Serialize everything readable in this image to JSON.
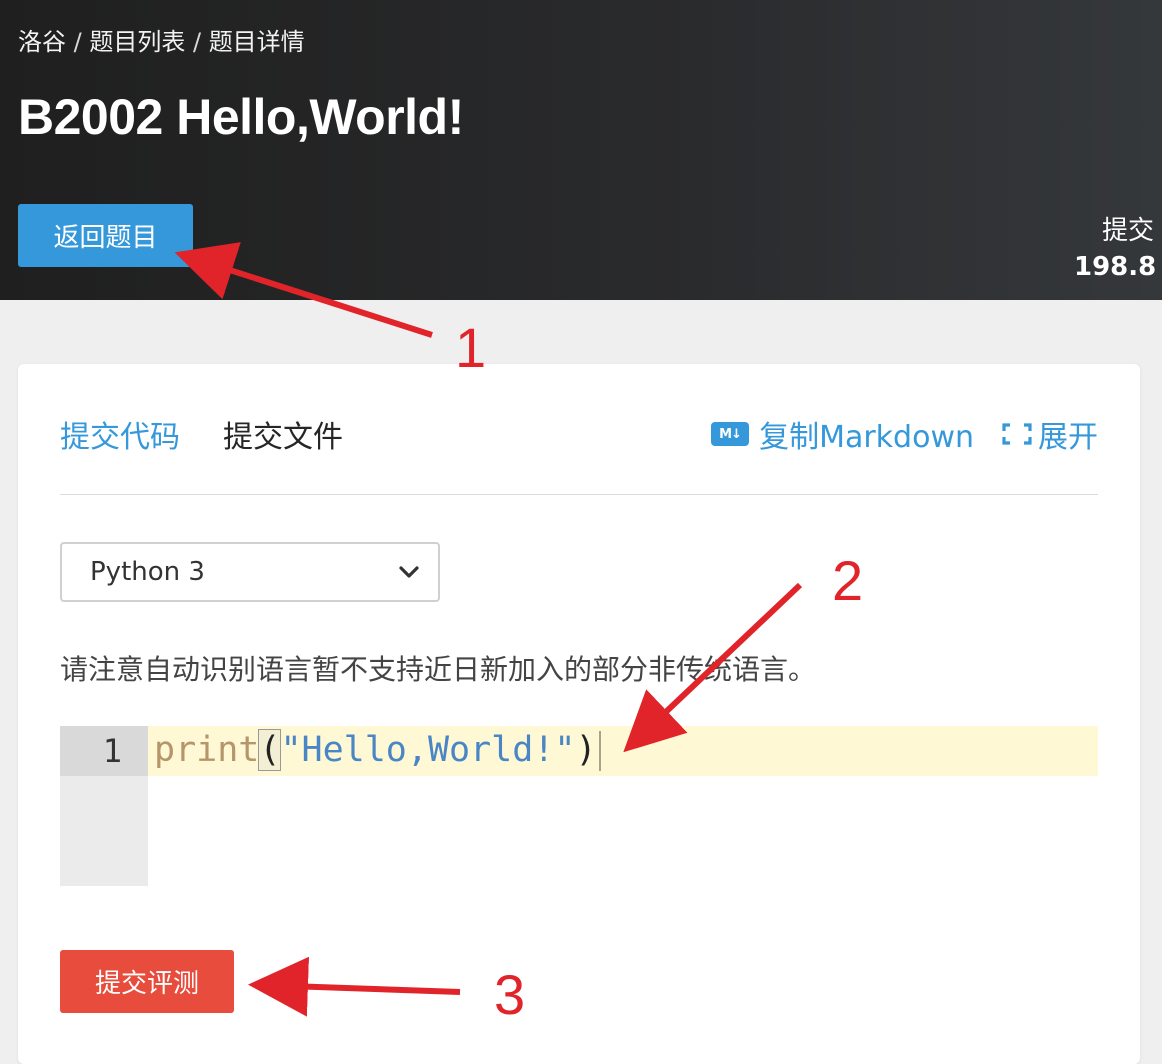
{
  "header": {
    "breadcrumb": [
      "洛谷",
      "题目列表",
      "题目详情"
    ],
    "breadcrumb_sep": " / ",
    "title": "B2002 Hello,World!",
    "back_button": "返回题目",
    "stat_label": "提交",
    "stat_value": "198.8"
  },
  "tabs": [
    {
      "label": "提交代码",
      "active": true
    },
    {
      "label": "提交文件",
      "active": false
    }
  ],
  "actions": {
    "copy_markdown": "复制Markdown",
    "md_icon_text": "M↓",
    "expand": "展开"
  },
  "language_select": {
    "value": "Python 3"
  },
  "notice": "请注意自动识别语言暂不支持近日新加入的部分非传统语言。",
  "editor": {
    "line_number": "1",
    "tokens": {
      "fn": "print",
      "open": "(",
      "str": "\"Hello,World!\"",
      "close": ")"
    }
  },
  "submit_button": "提交评测",
  "annotations": {
    "one": "1",
    "two": "2",
    "three": "3"
  },
  "colors": {
    "accent": "#3498db",
    "danger": "#e74c3c",
    "annotation": "#e0242a",
    "header_bg": "#2a2b2d"
  }
}
